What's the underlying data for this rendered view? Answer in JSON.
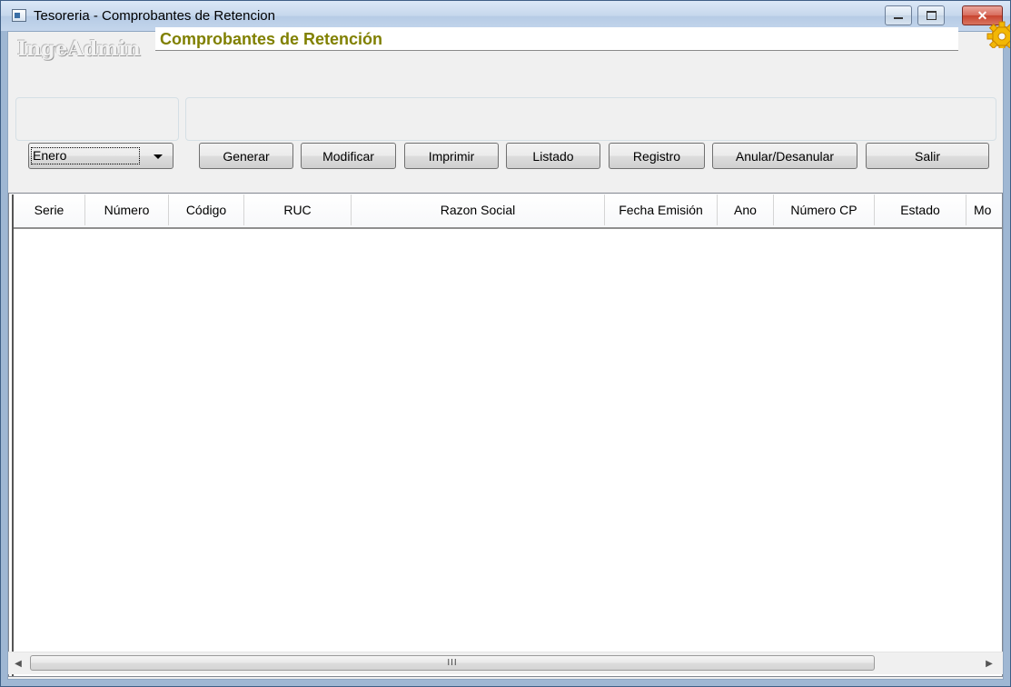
{
  "window": {
    "title": "Tesoreria - Comprobantes de Retencion",
    "close_glyph": "✕"
  },
  "header": {
    "brand": "IngeAdmin",
    "form_title": "Comprobantes de Retención"
  },
  "toolbar": {
    "month_select": "Enero",
    "buttons": {
      "generar": "Generar",
      "modificar": "Modificar",
      "imprimir": "Imprimir",
      "listado": "Listado",
      "registro": "Registro",
      "anular": "Anular/Desanular",
      "salir": "Salir"
    }
  },
  "grid": {
    "columns": [
      "Serie",
      "Número",
      "Código",
      "RUC",
      "Razon Social",
      "Fecha Emisión",
      "Ano",
      "Número CP",
      "Estado",
      "Mo"
    ]
  },
  "scrollbar": {
    "thumb_grip": "III",
    "left_arrow": "◀",
    "right_arrow": "▶"
  },
  "colors": {
    "title_accent": "#808000",
    "close_button": "#c8432f",
    "titlebar": "#c6d7ec"
  },
  "icons": [
    "app-icon",
    "gear-icon",
    "minimize-icon",
    "maximize-icon",
    "close-icon",
    "chevron-down-icon"
  ]
}
